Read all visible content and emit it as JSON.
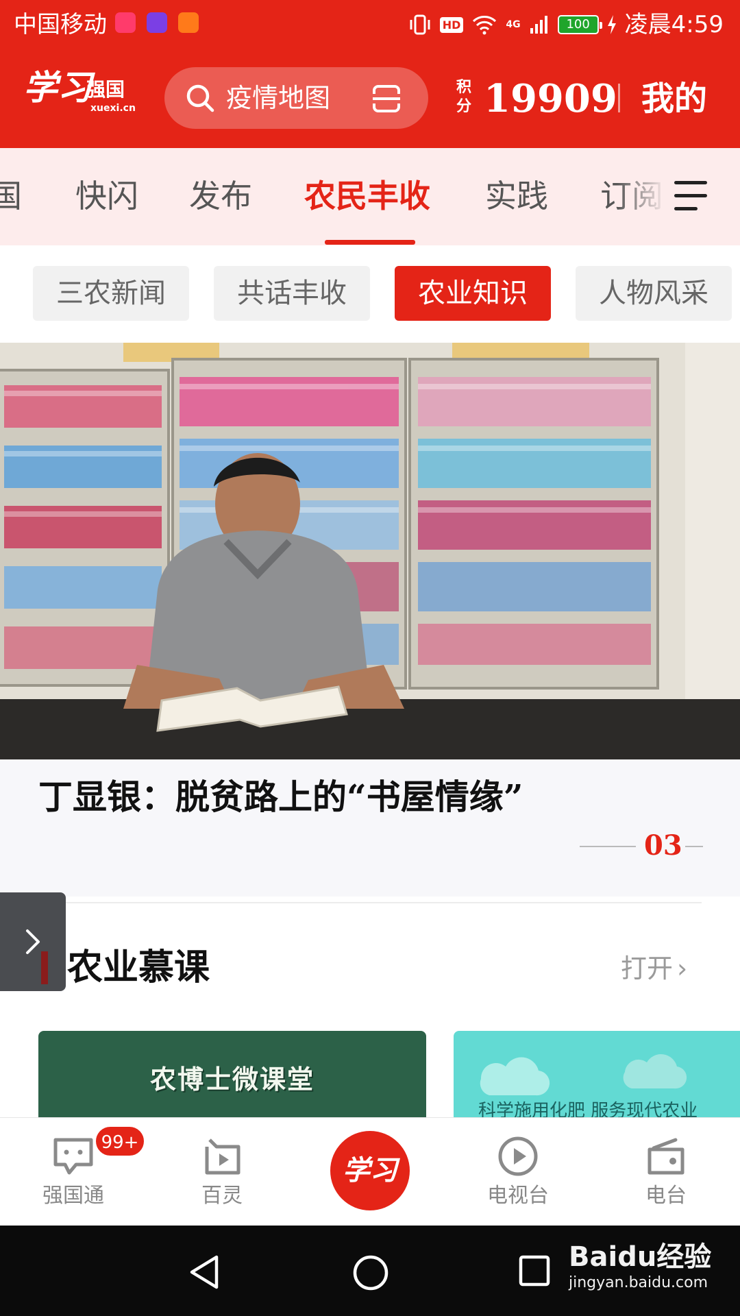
{
  "status_bar": {
    "carrier": "中国移动",
    "network": "4G",
    "hd": "HD",
    "battery": "100",
    "time": "凌晨4:59",
    "colors": {
      "battery_fill": "#1fa52b"
    }
  },
  "header": {
    "logo": {
      "script": "学习",
      "name": "强国",
      "domain": "xuexi.cn"
    },
    "search": {
      "placeholder": "疫情地图"
    },
    "points": {
      "label": "积分",
      "value": "19909"
    },
    "mine_label": "我的",
    "colors": {
      "brand_red": "#e42417"
    }
  },
  "channel_tabs": {
    "items": [
      {
        "label": "国"
      },
      {
        "label": "快闪"
      },
      {
        "label": "发布"
      },
      {
        "label": "农民丰收",
        "active": true
      },
      {
        "label": "实践"
      },
      {
        "label": "订阅"
      }
    ],
    "menu_icon": "hamburger-menu-icon"
  },
  "sub_tabs": {
    "items": [
      {
        "label": "三农新闻"
      },
      {
        "label": "共话丰收"
      },
      {
        "label": "农业知识",
        "active": true
      },
      {
        "label": "人物风采"
      }
    ]
  },
  "hero": {
    "title": "丁显银：脱贫路上的“书屋情缘”",
    "page_indicator": "03"
  },
  "section": {
    "title": "农业慕课",
    "open_label": "打开",
    "cards": [
      {
        "title": "农博士微课堂"
      },
      {
        "title": "科学施用化肥 服务现代农业"
      }
    ]
  },
  "bottom_nav": {
    "items": [
      {
        "label": "强国通",
        "icon": "chat-bubble-icon",
        "badge": "99+"
      },
      {
        "label": "百灵",
        "icon": "play-square-icon"
      },
      {
        "label": "学习",
        "icon": "xuexi-logo-icon"
      },
      {
        "label": "电视台",
        "icon": "play-circle-icon"
      },
      {
        "label": "电台",
        "icon": "radio-icon"
      }
    ]
  },
  "system_nav": {
    "watermark": {
      "main": "Baidu经验",
      "sub": "jingyan.baidu.com"
    }
  }
}
